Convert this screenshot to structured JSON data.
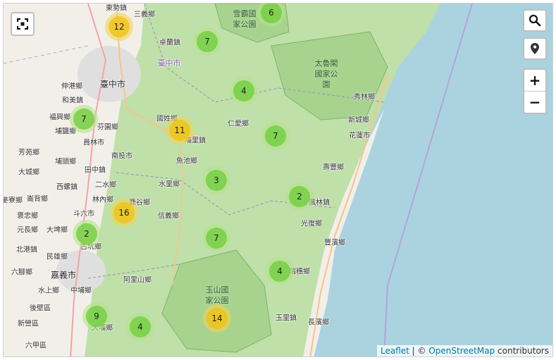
{
  "controls": {
    "fullscreen_icon": "fullscreen-icon",
    "search_icon": "search-icon",
    "locate_icon": "map-pin-icon",
    "zoom_in": "+",
    "zoom_out": "−"
  },
  "attribution": {
    "leaflet": "Leaflet",
    "separator": " | © ",
    "osm": "OpenStreetMap",
    "suffix": " contributors"
  },
  "place_labels": {
    "dongshi": "東勢鎮",
    "sanyi": "三義鄉",
    "zhuolan": "卓蘭鎮",
    "taichung_city": "臺中市",
    "shengzhong": "伸港鄉",
    "hemei": "和美鎮",
    "fuxing": "福興鄉",
    "fenyuan": "芬園鄉",
    "puyan": "埔鹽鄉",
    "yuanlin": "員林市",
    "fangyuan": "芳苑鄉",
    "nantou_city": "南投市",
    "puxin": "埔頭鄉",
    "tianzhong": "田中鎮",
    "dacheng": "大城鄉",
    "xizhou": "西螺鎮",
    "ershui": "二水鄉",
    "erlun": "崙背鄉",
    "mailiao": "麥寮鄉",
    "linnei": "林內鄉",
    "lugu": "鹿谷鄉",
    "douliu": "斗六市",
    "baozhong": "褒忠鄉",
    "yuanzhang": "元長鄉",
    "dapu": "大埤鄉",
    "gukeng": "古坑鄉",
    "beigang": "北港鎮",
    "minxiong": "民雄鄉",
    "liujiao": "六腳鄉",
    "chiayi_city": "嘉義市",
    "shuishang": "水上鄉",
    "zhongpu": "中埔鄉",
    "houbi": "後壁區",
    "xinying": "新營區",
    "liujia": "六甲區",
    "dapu2": "大埔鄉",
    "alishan": "阿里山鄉",
    "xinyi": "信義鄉",
    "shuili": "水里鄉",
    "yuchi": "魚池鄉",
    "puli": "埔里鎮",
    "guoxing": "國姓鄉",
    "renai": "仁愛鄉",
    "xiulin": "秀林鄉",
    "xincheng": "新城鄉",
    "hualien_city": "花蓮市",
    "shoufeng": "壽豐鄉",
    "fenglin": "鳳林鎮",
    "guangfu": "光復鄉",
    "fengbin": "豐濱鄉",
    "ruisui": "瑞穗鄉",
    "yuli": "玉里鎮",
    "changbin": "長濱鄉",
    "taichung_purple": "臺中市",
    "sheipa": "雪霸國家公園",
    "taroko": "太魯閣國家公園",
    "yushan": "玉山國家公園"
  },
  "clusters": [
    {
      "count": "12",
      "size": "medium"
    },
    {
      "count": "6",
      "size": "small"
    },
    {
      "count": "7",
      "size": "small"
    },
    {
      "count": "7",
      "size": "small"
    },
    {
      "count": "4",
      "size": "small"
    },
    {
      "count": "11",
      "size": "medium"
    },
    {
      "count": "7",
      "size": "small"
    },
    {
      "count": "3",
      "size": "small"
    },
    {
      "count": "2",
      "size": "small"
    },
    {
      "count": "16",
      "size": "medium"
    },
    {
      "count": "2",
      "size": "small"
    },
    {
      "count": "7",
      "size": "small"
    },
    {
      "count": "4",
      "size": "small"
    },
    {
      "count": "9",
      "size": "small"
    },
    {
      "count": "4",
      "size": "small"
    },
    {
      "count": "14",
      "size": "medium"
    }
  ]
}
